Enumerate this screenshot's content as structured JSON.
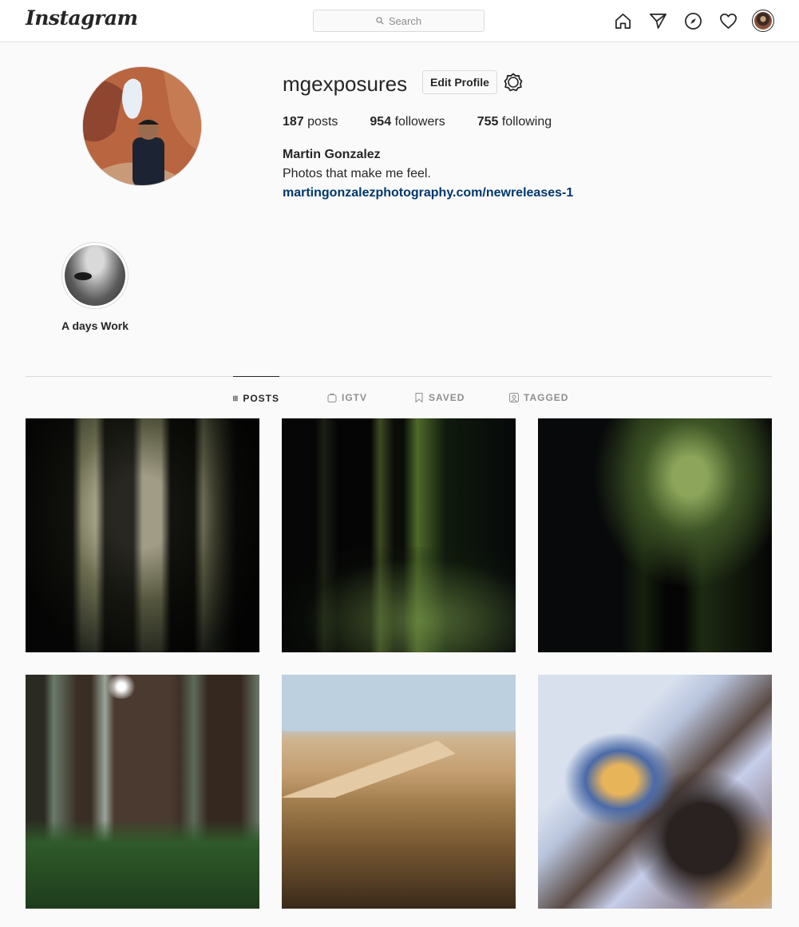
{
  "header": {
    "logo": "Instagram",
    "search_placeholder": "Search"
  },
  "profile": {
    "username": "mgexposures",
    "edit_button": "Edit Profile",
    "stats": {
      "posts_count": "187",
      "posts_label": "posts",
      "followers_count": "954",
      "followers_label": "followers",
      "following_count": "755",
      "following_label": "following"
    },
    "full_name": "Martin Gonzalez",
    "bio": "Photos that make me feel.",
    "website": "martingonzalezphotography.com/newreleases-1"
  },
  "highlights": [
    {
      "label": "A days Work"
    }
  ],
  "tabs": [
    {
      "label": "POSTS",
      "active": true
    },
    {
      "label": "IGTV",
      "active": false
    },
    {
      "label": "SAVED",
      "active": false
    },
    {
      "label": "TAGGED",
      "active": false
    }
  ],
  "colors": {
    "link": "#00376b",
    "border": "#dbdbdb",
    "muted": "#8e8e8e",
    "text": "#262626"
  }
}
